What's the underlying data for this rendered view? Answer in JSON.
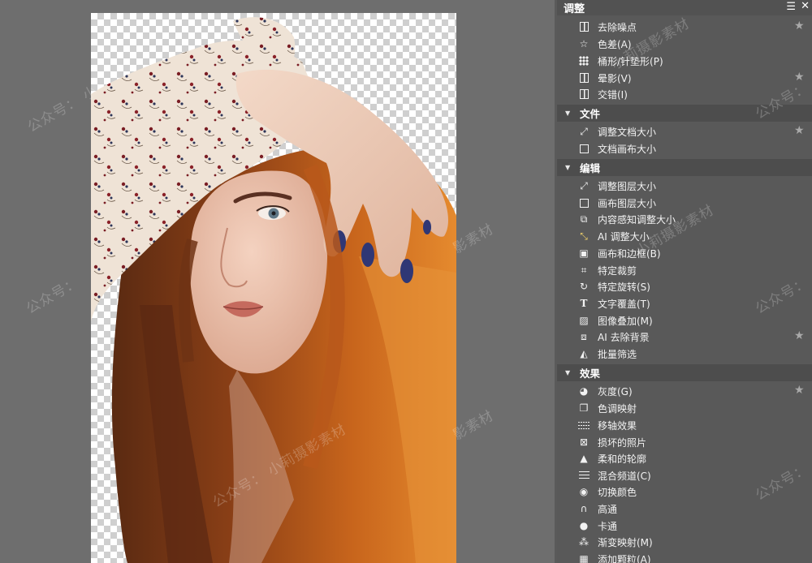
{
  "panel": {
    "title": "调整",
    "menu_icon": "hamburger-menu-icon",
    "close_icon": "close-icon"
  },
  "sections": {
    "top_items": [
      {
        "label": "去除噪点",
        "icon": "denoise-icon",
        "starred": true
      },
      {
        "label": "色差(A)",
        "icon": "star-outline-icon",
        "starred": false
      },
      {
        "label": "桶形/针垫形(P)",
        "icon": "dot-grid-icon",
        "starred": false
      },
      {
        "label": "晕影(V)",
        "icon": "vignette-icon",
        "starred": true
      },
      {
        "label": "交错(I)",
        "icon": "interlace-icon",
        "starred": false
      }
    ],
    "file": {
      "label": "文件",
      "items": [
        {
          "label": "调整文档大小",
          "icon": "resize-arrows-icon",
          "starred": true
        },
        {
          "label": "文档画布大小",
          "icon": "canvas-square-icon",
          "starred": false
        }
      ]
    },
    "edit": {
      "label": "编辑",
      "items": [
        {
          "label": "调整图层大小",
          "icon": "resize-arrows-icon",
          "starred": false
        },
        {
          "label": "画布图层大小",
          "icon": "canvas-square-icon",
          "starred": false
        },
        {
          "label": "内容感知调整大小",
          "icon": "content-aware-icon",
          "starred": false
        },
        {
          "label": "AI 调整大小",
          "icon": "ai-resize-icon",
          "starred": false
        },
        {
          "label": "画布和边框(B)",
          "icon": "frame-icon",
          "starred": false
        },
        {
          "label": "特定裁剪",
          "icon": "crop-icon",
          "starred": false
        },
        {
          "label": "特定旋转(S)",
          "icon": "rotate-icon",
          "starred": false
        },
        {
          "label": "文字覆盖(T)",
          "icon": "text-overlay-icon",
          "starred": false
        },
        {
          "label": "图像叠加(M)",
          "icon": "image-overlay-icon",
          "starred": false
        },
        {
          "label": "AI 去除背景",
          "icon": "ai-remove-bg-icon",
          "starred": true
        },
        {
          "label": "批量筛选",
          "icon": "batch-filter-icon",
          "starred": false
        }
      ]
    },
    "effects": {
      "label": "效果",
      "items": [
        {
          "label": "灰度(G)",
          "icon": "grayscale-icon",
          "starred": true
        },
        {
          "label": "色调映射",
          "icon": "tone-map-icon",
          "starred": false
        },
        {
          "label": "移轴效果",
          "icon": "tilt-shift-icon",
          "starred": false
        },
        {
          "label": "损坏的照片",
          "icon": "damaged-photo-icon",
          "starred": false
        },
        {
          "label": "柔和的轮廓",
          "icon": "soft-edge-icon",
          "starred": false
        },
        {
          "label": "混合频道(C)",
          "icon": "mix-channel-icon",
          "starred": false
        },
        {
          "label": "切换颜色",
          "icon": "swap-color-icon",
          "starred": false
        },
        {
          "label": "高通",
          "icon": "high-pass-icon",
          "starred": false
        },
        {
          "label": "卡通",
          "icon": "cartoon-icon",
          "starred": false
        },
        {
          "label": "渐变映射(M)",
          "icon": "gradient-map-icon",
          "starred": false
        },
        {
          "label": "添加颗粒(A)",
          "icon": "add-grain-icon",
          "starred": false
        }
      ]
    }
  },
  "watermark_text": {
    "account": "公众号：",
    "brand": "小莉摄影素材",
    "brand_short": "影素材",
    "fragment": "小"
  },
  "colors": {
    "panel_bg": "#595959",
    "section_header_bg": "#4d4d4d",
    "canvas_bg": "#6e6e6e",
    "star": "#a9a9a9"
  }
}
